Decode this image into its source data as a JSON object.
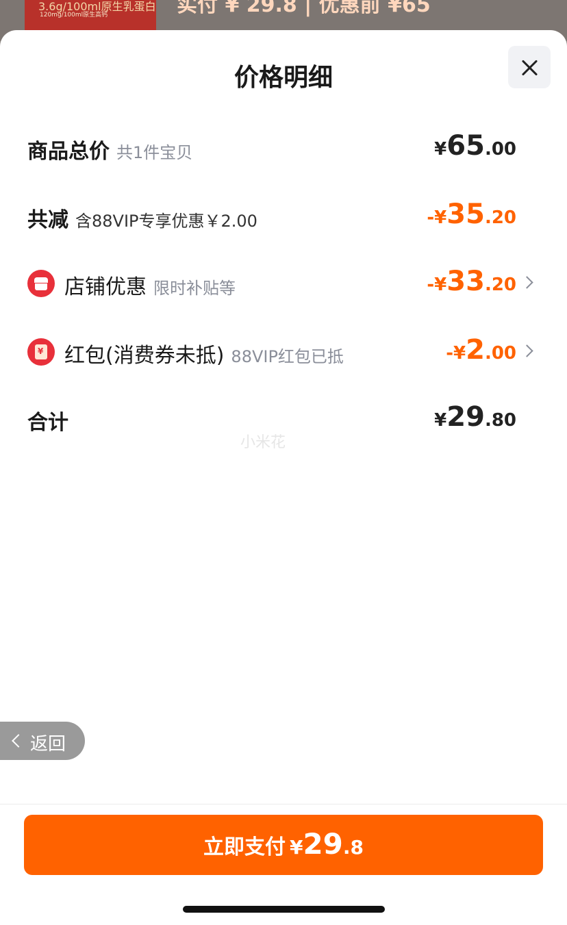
{
  "background": {
    "thumb_title": "3.6g/100ml原生乳蛋白",
    "thumb_sub": "120mg/100ml原生高钙",
    "price_text": "实付 ¥ 29.8 | 优惠前 ¥65"
  },
  "sheet": {
    "title": "价格明细",
    "close_label": "×"
  },
  "rows": {
    "total": {
      "label": "商品总价",
      "sub": "共1件宝贝",
      "currency": "¥",
      "int": "65",
      "dec": ".00"
    },
    "reduction": {
      "label": "共减",
      "sub": "含88VIP专享优惠￥2.00",
      "currency": "-¥",
      "int": "35",
      "dec": ".20"
    },
    "shop": {
      "label": "店铺优惠",
      "sub": "限时补贴等",
      "currency": "-¥",
      "int": "33",
      "dec": ".20"
    },
    "redpacket": {
      "label": "红包(消费券未抵)",
      "sub": "88VIP红包已抵",
      "currency": "-¥",
      "int": "2",
      "dec": ".00"
    },
    "sum": {
      "label": "合计",
      "currency": "¥",
      "int": "29",
      "dec": ".80"
    }
  },
  "watermark": "小米花",
  "back": {
    "label": "返回"
  },
  "pay": {
    "label": "立即支付",
    "currency": "¥",
    "int": "29",
    "dec": ".8"
  },
  "colors": {
    "accent": "#ff6200",
    "icon_red": "#e8303a"
  }
}
